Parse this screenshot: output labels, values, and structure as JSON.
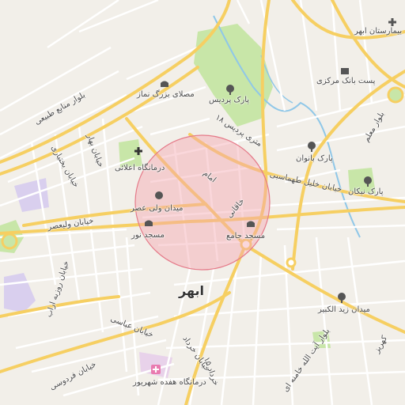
{
  "map": {
    "city_label": "ابهر",
    "search_circle_color": "#f4a6b0",
    "colors": {
      "background": "#f2efe9",
      "major_road": "#f6cf62",
      "minor_road": "#ffffff",
      "park": "#c8e6a8",
      "water": "#8fc7e8",
      "purple_area": "#d9cfee"
    },
    "labels": {
      "hospital_top": "بیمارستان ابهر",
      "bank_post": "پست بانک مرکزی",
      "park_pardis": "پارک پردیس",
      "mosalla": "مصلای بزرگ نماز",
      "blvd_tabibi": "بلوار منابع طبیعی",
      "street_18m": "۱۸ متری پردیس",
      "blvd_moalem": "بلوار معلم",
      "park_banovan": "پارک بانوان",
      "clinic_ellahi": "درمانگاه اعلائی",
      "street_khalil": "خیابان خلیل طهماسبی",
      "park_nikan": "پارک نیکان",
      "street_bahar": "خیابان بهار",
      "street_bakhtiari": "خیابان بختیاری",
      "imam": "امام",
      "square_valiasr": "میدان ولی عصر",
      "khaqani": "خاقانی",
      "street_valiasr": "خیابان ولیعصر",
      "mosque_noor": "مسجد نور",
      "mosque_jame": "مسجد جامع",
      "street_rozbeh": "خیابان روزبه اراب",
      "square_zeid": "میدان زید الکبیر",
      "blvd_ayatollah": "بلوار آیت الله خامنه ای",
      "street_abbasi": "خیابان عباسی",
      "street_khordad": "خیابان خرداد",
      "khordad_15": "۱۵ خرداد",
      "street_ferdowsi": "خیابان فردوسی",
      "clinic_17shahrivar": "درمانگاه هفده شهریور",
      "kahrizak": "کهریز"
    }
  }
}
